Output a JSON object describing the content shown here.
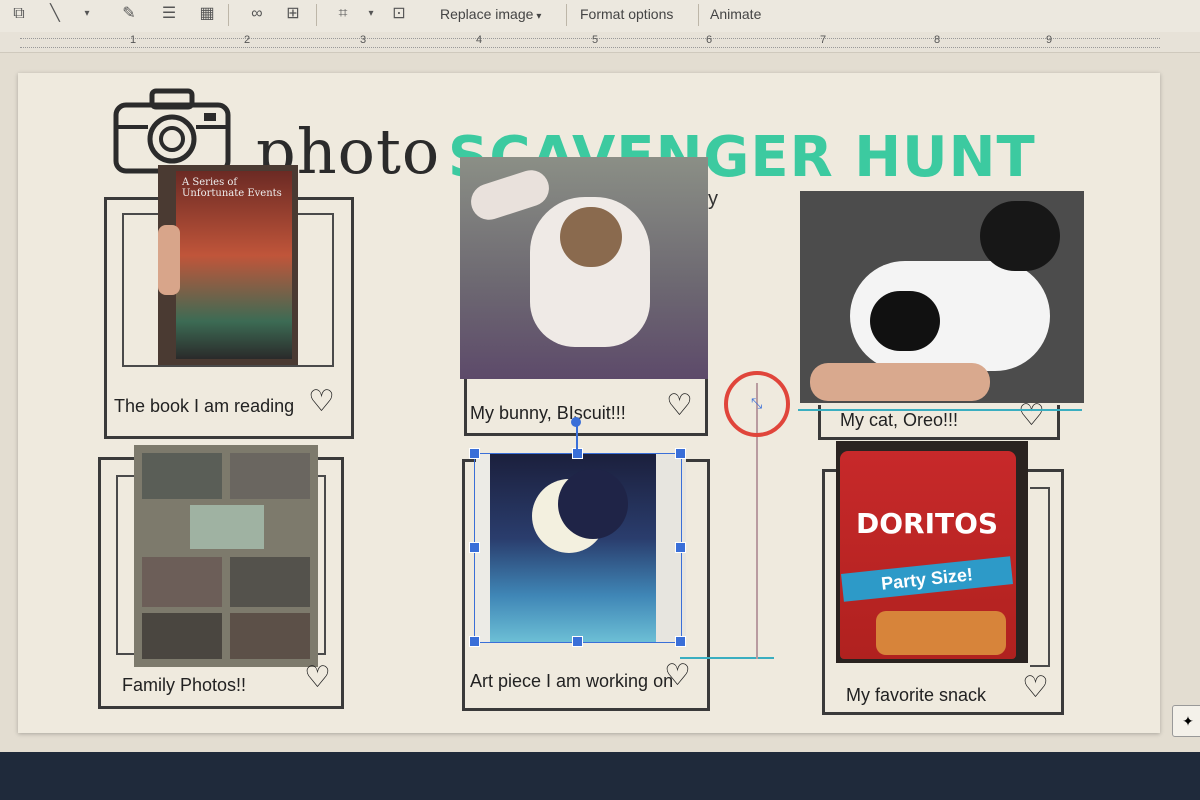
{
  "toolbar": {
    "replace_image_label": "Replace image",
    "format_options_label": "Format options",
    "animate_label": "Animate"
  },
  "ruler": {
    "marks": [
      "1",
      "2",
      "3",
      "4",
      "5",
      "6",
      "7",
      "8",
      "9"
    ]
  },
  "slide": {
    "title_word1": "photo",
    "title_word2": "SCAVENGER HUNT",
    "stray_char": "y",
    "cards": [
      {
        "caption": "The book I am reading"
      },
      {
        "caption": "My bunny, BIscuit!!!"
      },
      {
        "caption": "My cat, Oreo!!!"
      },
      {
        "caption": "Family Photos!!"
      },
      {
        "caption": "Art piece I am working on"
      },
      {
        "caption": "My favorite snack"
      }
    ],
    "book_cover_text": "A Series of Unfortunate Events",
    "doritos_brand": "DORITOS",
    "doritos_sub": "Party Size!"
  },
  "colors": {
    "accent": "#3ccaa0",
    "selection": "#3a6fd8",
    "ring": "#e0453b"
  }
}
